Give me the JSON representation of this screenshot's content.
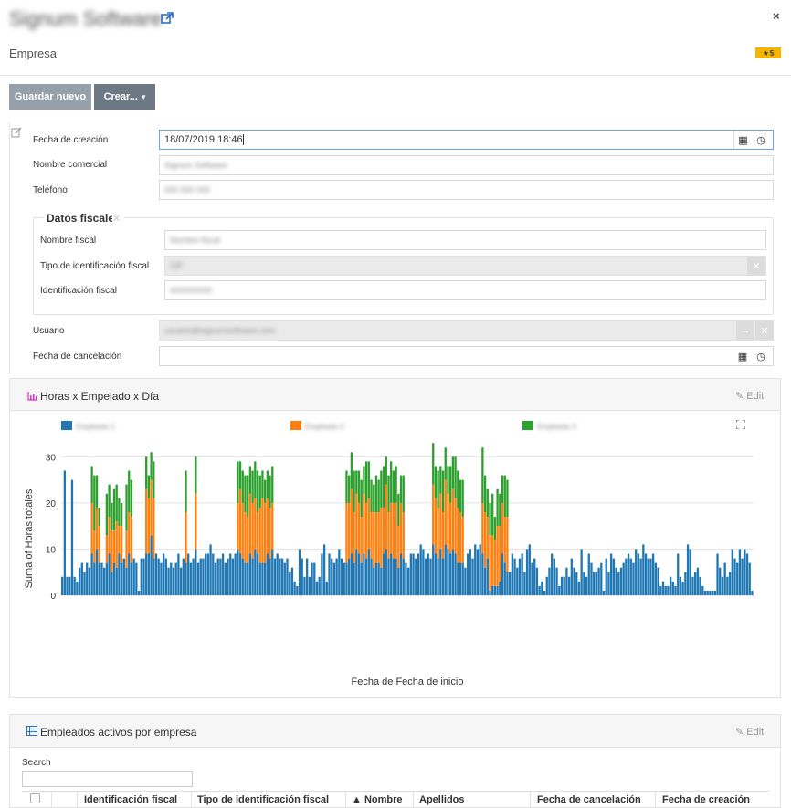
{
  "header": {
    "title": "Signum Software",
    "subtitle": "Empresa",
    "badge_count": "5",
    "close": "×"
  },
  "toolbar": {
    "save_label": "Guardar nuevo",
    "create_label": "Crear...",
    "create_caret": "▾"
  },
  "form": {
    "fecha_creacion_label": "Fecha de creación",
    "fecha_creacion_value": "18/07/2019 18:46",
    "nombre_comercial_label": "Nombre comercial",
    "nombre_comercial_value": "Signum Software",
    "telefono_label": "Teléfono",
    "telefono_value": "000 000 000",
    "fiscal_legend": "Datos fiscales",
    "nombre_fiscal_label": "Nombre fiscal",
    "nombre_fiscal_value": "Nombre fiscal",
    "tipo_id_label": "Tipo de identificación fiscal",
    "tipo_id_value": "CIF",
    "id_fiscal_label": "Identificación fiscal",
    "id_fiscal_value": "A00000000",
    "usuario_label": "Usuario",
    "usuario_value": "usuario@signumsoftware.com",
    "fecha_cancelacion_label": "Fecha de cancelación",
    "fecha_cancelacion_value": ""
  },
  "chart_panel": {
    "title": "Horas x Empelado x Día",
    "edit_label": "Edit"
  },
  "chart_data": {
    "type": "bar",
    "stacked": true,
    "ylabel": "Suma of Horas totales",
    "xlabel": "Fecha de Fecha de inicio",
    "ylim": [
      0,
      36
    ],
    "yticks": [
      0,
      10,
      20,
      30
    ],
    "grid": true,
    "legend_position": "top",
    "series": [
      {
        "name": "Empleado 1",
        "color": "#1f77b4",
        "values": [
          4,
          27,
          4,
          4,
          25,
          4,
          3,
          6,
          7,
          5,
          7,
          6,
          9,
          7,
          10,
          7,
          7,
          6,
          7,
          9,
          5,
          7,
          6,
          9,
          7,
          8,
          6,
          9,
          7,
          8,
          7,
          1,
          8,
          8,
          9,
          9,
          13,
          8,
          9,
          8,
          7,
          9,
          8,
          6,
          7,
          6,
          7,
          9,
          6,
          8,
          7,
          9,
          7,
          8,
          10,
          7,
          8,
          8,
          9,
          9,
          11,
          9,
          7,
          8,
          8,
          9,
          7,
          8,
          9,
          8,
          9,
          10,
          9,
          8,
          7,
          7,
          9,
          8,
          10,
          9,
          7,
          7,
          7,
          9,
          8,
          10,
          8,
          9,
          8,
          8,
          7,
          8,
          5,
          6,
          3,
          2,
          10,
          8,
          4,
          8,
          4,
          7,
          7,
          3,
          4,
          9,
          11,
          3,
          9,
          8,
          7,
          8,
          10,
          8,
          7,
          7,
          8,
          9,
          7,
          10,
          9,
          7,
          9,
          8,
          10,
          8,
          6,
          7,
          7,
          6,
          9,
          10,
          8,
          9,
          8,
          8,
          6,
          9,
          8,
          7,
          6,
          9,
          9,
          8,
          9,
          11,
          10,
          8,
          9,
          8,
          11,
          9,
          8,
          10,
          8,
          11,
          10,
          9,
          10,
          9,
          7,
          7,
          7,
          6,
          9,
          10,
          8,
          11,
          10,
          11,
          9,
          6,
          8,
          1,
          2,
          2,
          2,
          3,
          9,
          7,
          5,
          5,
          9,
          8,
          6,
          8,
          9,
          5,
          10,
          11,
          7,
          8,
          6,
          2,
          3,
          1,
          4,
          6,
          9,
          8,
          6,
          2,
          4,
          4,
          6,
          4,
          8,
          6,
          5,
          3,
          10,
          5,
          4,
          9,
          7,
          5,
          5,
          6,
          7,
          1,
          8,
          5,
          9,
          8,
          6,
          5,
          6,
          7,
          8,
          9,
          8,
          7,
          10,
          9,
          8,
          11,
          9,
          8,
          8,
          9,
          7,
          6,
          2,
          3,
          2,
          2,
          4,
          3,
          2,
          9,
          4,
          3,
          5,
          11,
          10,
          4,
          5,
          6,
          4,
          2,
          1,
          1,
          1,
          1,
          1,
          9,
          6,
          4,
          7,
          4,
          5,
          10,
          8,
          7,
          10,
          8,
          10,
          9,
          7,
          1
        ]
      },
      {
        "name": "Empleado 2",
        "color": "#ff7f0e",
        "values": [
          0,
          0,
          0,
          0,
          0,
          0,
          0,
          0,
          0,
          0,
          0,
          0,
          11,
          7,
          9,
          8,
          0,
          0,
          6,
          8,
          9,
          7,
          10,
          6,
          8,
          0,
          8,
          9,
          10,
          0,
          0,
          0,
          0,
          0,
          14,
          12,
          12,
          13,
          0,
          0,
          0,
          0,
          0,
          0,
          0,
          0,
          0,
          0,
          0,
          0,
          11,
          0,
          0,
          0,
          12,
          0,
          0,
          0,
          0,
          0,
          0,
          0,
          0,
          0,
          0,
          0,
          0,
          0,
          0,
          0,
          0,
          10,
          14,
          12,
          11,
          10,
          13,
          12,
          11,
          9,
          12,
          14,
          13,
          12,
          11,
          10,
          0,
          0,
          0,
          0,
          0,
          0,
          0,
          0,
          0,
          0,
          0,
          0,
          0,
          0,
          0,
          0,
          0,
          0,
          0,
          0,
          0,
          0,
          0,
          0,
          0,
          0,
          0,
          0,
          0,
          13,
          12,
          14,
          11,
          12,
          11,
          10,
          13,
          12,
          11,
          10,
          12,
          11,
          11,
          13,
          10,
          14,
          10,
          11,
          12,
          12,
          9,
          11,
          10,
          0,
          0,
          0,
          0,
          0,
          0,
          0,
          0,
          0,
          0,
          0,
          13,
          12,
          11,
          12,
          10,
          14,
          12,
          11,
          13,
          12,
          12,
          11,
          10,
          0,
          0,
          0,
          0,
          0,
          0,
          0,
          11,
          12,
          9,
          12,
          11,
          10,
          13,
          12,
          11,
          10,
          12,
          0,
          0,
          0,
          0,
          0,
          0,
          0,
          0,
          0,
          0,
          0,
          0,
          0,
          0,
          0,
          0,
          0,
          0,
          0,
          0,
          0,
          0,
          0,
          0,
          0,
          0,
          0,
          0,
          0,
          0,
          0,
          0,
          0,
          0,
          0,
          0,
          0,
          0,
          0,
          0,
          0,
          0,
          0,
          0,
          0,
          0,
          0,
          0,
          0,
          0,
          0,
          0,
          0,
          0,
          0,
          0,
          0,
          0,
          0,
          0,
          0,
          0,
          0,
          0,
          0,
          0,
          0,
          0,
          0,
          0,
          0,
          0,
          0,
          0,
          0,
          0,
          0,
          0,
          0,
          0,
          0,
          0,
          0,
          0,
          0,
          0,
          0,
          0,
          0,
          0,
          0,
          0,
          0,
          0,
          0,
          0,
          0,
          0
        ]
      },
      {
        "name": "Empleado 3",
        "color": "#2ca02c",
        "values": [
          0,
          0,
          0,
          0,
          0,
          0,
          0,
          0,
          0,
          0,
          0,
          0,
          8,
          12,
          7,
          4,
          0,
          0,
          9,
          7,
          6,
          9,
          8,
          6,
          5,
          0,
          10,
          9,
          8,
          0,
          0,
          0,
          0,
          0,
          7,
          5,
          6,
          8,
          0,
          0,
          0,
          0,
          0,
          0,
          0,
          0,
          0,
          0,
          0,
          0,
          9,
          0,
          0,
          0,
          8,
          0,
          0,
          0,
          0,
          0,
          0,
          0,
          0,
          0,
          0,
          0,
          0,
          0,
          0,
          0,
          0,
          9,
          6,
          7,
          8,
          9,
          6,
          7,
          8,
          9,
          7,
          6,
          5,
          6,
          7,
          8,
          0,
          0,
          0,
          0,
          0,
          0,
          0,
          0,
          0,
          0,
          0,
          0,
          0,
          0,
          0,
          0,
          0,
          0,
          0,
          0,
          0,
          0,
          0,
          0,
          0,
          0,
          0,
          0,
          0,
          7,
          6,
          8,
          9,
          5,
          7,
          8,
          6,
          9,
          8,
          7,
          6,
          8,
          7,
          8,
          9,
          6,
          8,
          9,
          7,
          8,
          7,
          6,
          8,
          0,
          0,
          0,
          0,
          0,
          0,
          0,
          0,
          0,
          0,
          0,
          9,
          7,
          8,
          6,
          9,
          7,
          6,
          8,
          7,
          9,
          8,
          7,
          8,
          0,
          0,
          0,
          0,
          0,
          0,
          0,
          12,
          8,
          6,
          7,
          9,
          5,
          8,
          7,
          6,
          9,
          8,
          0,
          0,
          0,
          0,
          0,
          0,
          0,
          0,
          0,
          0,
          0,
          0,
          0,
          0,
          0,
          0,
          0,
          0,
          0,
          0,
          0,
          0,
          0,
          0,
          0,
          0,
          0,
          0,
          0,
          0,
          0,
          0,
          0,
          0,
          0,
          0,
          0,
          0,
          0,
          0,
          0,
          0,
          0,
          0,
          0,
          0,
          0,
          0,
          0,
          0,
          0,
          0,
          0,
          0,
          0,
          0,
          0,
          0,
          0,
          0,
          0,
          0,
          0,
          0,
          0,
          0,
          0,
          0,
          0,
          0,
          0,
          0,
          0,
          0,
          0,
          0,
          0,
          0,
          0,
          0,
          0,
          0,
          0,
          0,
          0,
          0,
          0,
          0,
          0,
          0,
          0,
          0,
          0,
          0,
          0,
          0,
          0,
          0
        ]
      }
    ]
  },
  "table_panel": {
    "title": "Empleados activos por empresa",
    "edit_label": "Edit",
    "search_label": "Search",
    "columns": [
      "Identificación fiscal",
      "Tipo de identificación fiscal",
      "▲ Nombre",
      "Apellidos",
      "Fecha de cancelación",
      "Fecha de creación"
    ]
  },
  "colors": {
    "accent_blue": "#1f77b4",
    "accent_orange": "#ff7f0e",
    "accent_green": "#2ca02c",
    "badge": "#f4b400",
    "button_primary": "#96a0ab",
    "button_secondary": "#6c7883"
  },
  "icons": {
    "external": "external-link-icon",
    "close": "close-icon",
    "star": "star-icon",
    "calendar": "calendar-icon",
    "clock": "clock-icon",
    "arrow": "arrow-right-icon",
    "remove": "remove-icon",
    "chart": "bar-chart-icon",
    "table": "table-icon",
    "edit": "pencil-icon",
    "fullscreen": "fullscreen-icon"
  }
}
